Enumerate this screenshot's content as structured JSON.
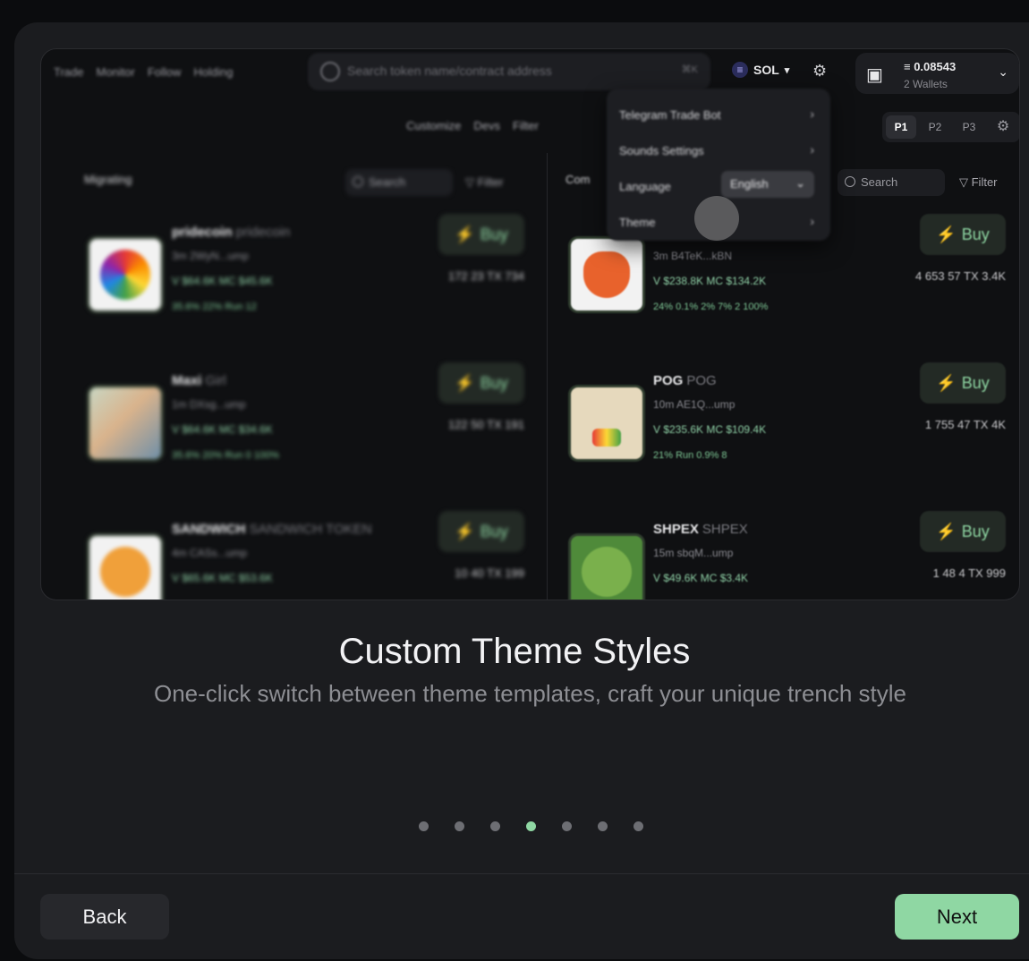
{
  "preview": {
    "nav": [
      "Trade",
      "Monitor",
      "Follow",
      "Holding"
    ],
    "search_placeholder": "Search token name/contract address",
    "search_kbd": "⌘K",
    "chain": "SOL",
    "wallet_balance": "0.08543",
    "wallet_count": "2 Wallets",
    "toolbar": [
      "Customize",
      "Devs",
      "Filter"
    ],
    "pages": [
      "P1",
      "P2",
      "P3"
    ],
    "col_a_title": "Migrating",
    "col_b_title": "Com",
    "search_label": "Search",
    "filter_label": "Filter",
    "buy_label": "Buy",
    "menu": {
      "items": [
        "Telegram Trade Bot",
        "Sounds Settings",
        "Language",
        "Theme"
      ],
      "language_value": "English"
    },
    "tokens_a": [
      {
        "name": "pridecoin",
        "sub": "pridecoin",
        "line1": "3m  2WyN...ump",
        "line2": "V $64.6K  MC $45.6K",
        "stats": "172  23  TX 734",
        "small": "35.6%  22%  Run  12"
      },
      {
        "name": "Maxi",
        "sub": "Girl",
        "line1": "1m  DXsg...ump",
        "line2": "V $64.6K  MC $34.6K",
        "stats": "122  50  TX 191",
        "small": "35.6%  20%  Run  0  100%"
      },
      {
        "name": "SANDWICH",
        "sub": "SANDWICH TOKEN",
        "line1": "4m  CASs...ump",
        "line2": "V $65.6K  MC $53.6K",
        "stats": "10  40  TX 199",
        "small": ""
      }
    ],
    "tokens_b": [
      {
        "name": "",
        "sub": "",
        "line1": "3m  B4TeK...kBN",
        "line2": "V $238.8K  MC $134.2K",
        "stats": "4  653  57  TX 3.4K",
        "small": "24%  0.1%  2%  7%  2  100%"
      },
      {
        "name": "POG",
        "sub": "POG",
        "line1": "10m  AE1Q...ump",
        "line2": "V $235.6K  MC $109.4K",
        "stats": "1  755  47  TX 4K",
        "small": "21%  Run  0.9%  8"
      },
      {
        "name": "SHPEX",
        "sub": "SHPEX",
        "line1": "15m  sbqM...ump",
        "line2": "V $49.6K  MC $3.4K",
        "stats": "1  48  4  TX 999",
        "small": ""
      }
    ]
  },
  "content": {
    "title": "Custom Theme Styles",
    "subtitle": "One-click switch between theme templates, craft your unique trench style"
  },
  "pagination": {
    "total": 7,
    "active_index": 3
  },
  "footer": {
    "back_label": "Back",
    "next_label": "Next"
  },
  "colors": {
    "accent": "#8fd7a3",
    "background": "#1b1c1f"
  }
}
